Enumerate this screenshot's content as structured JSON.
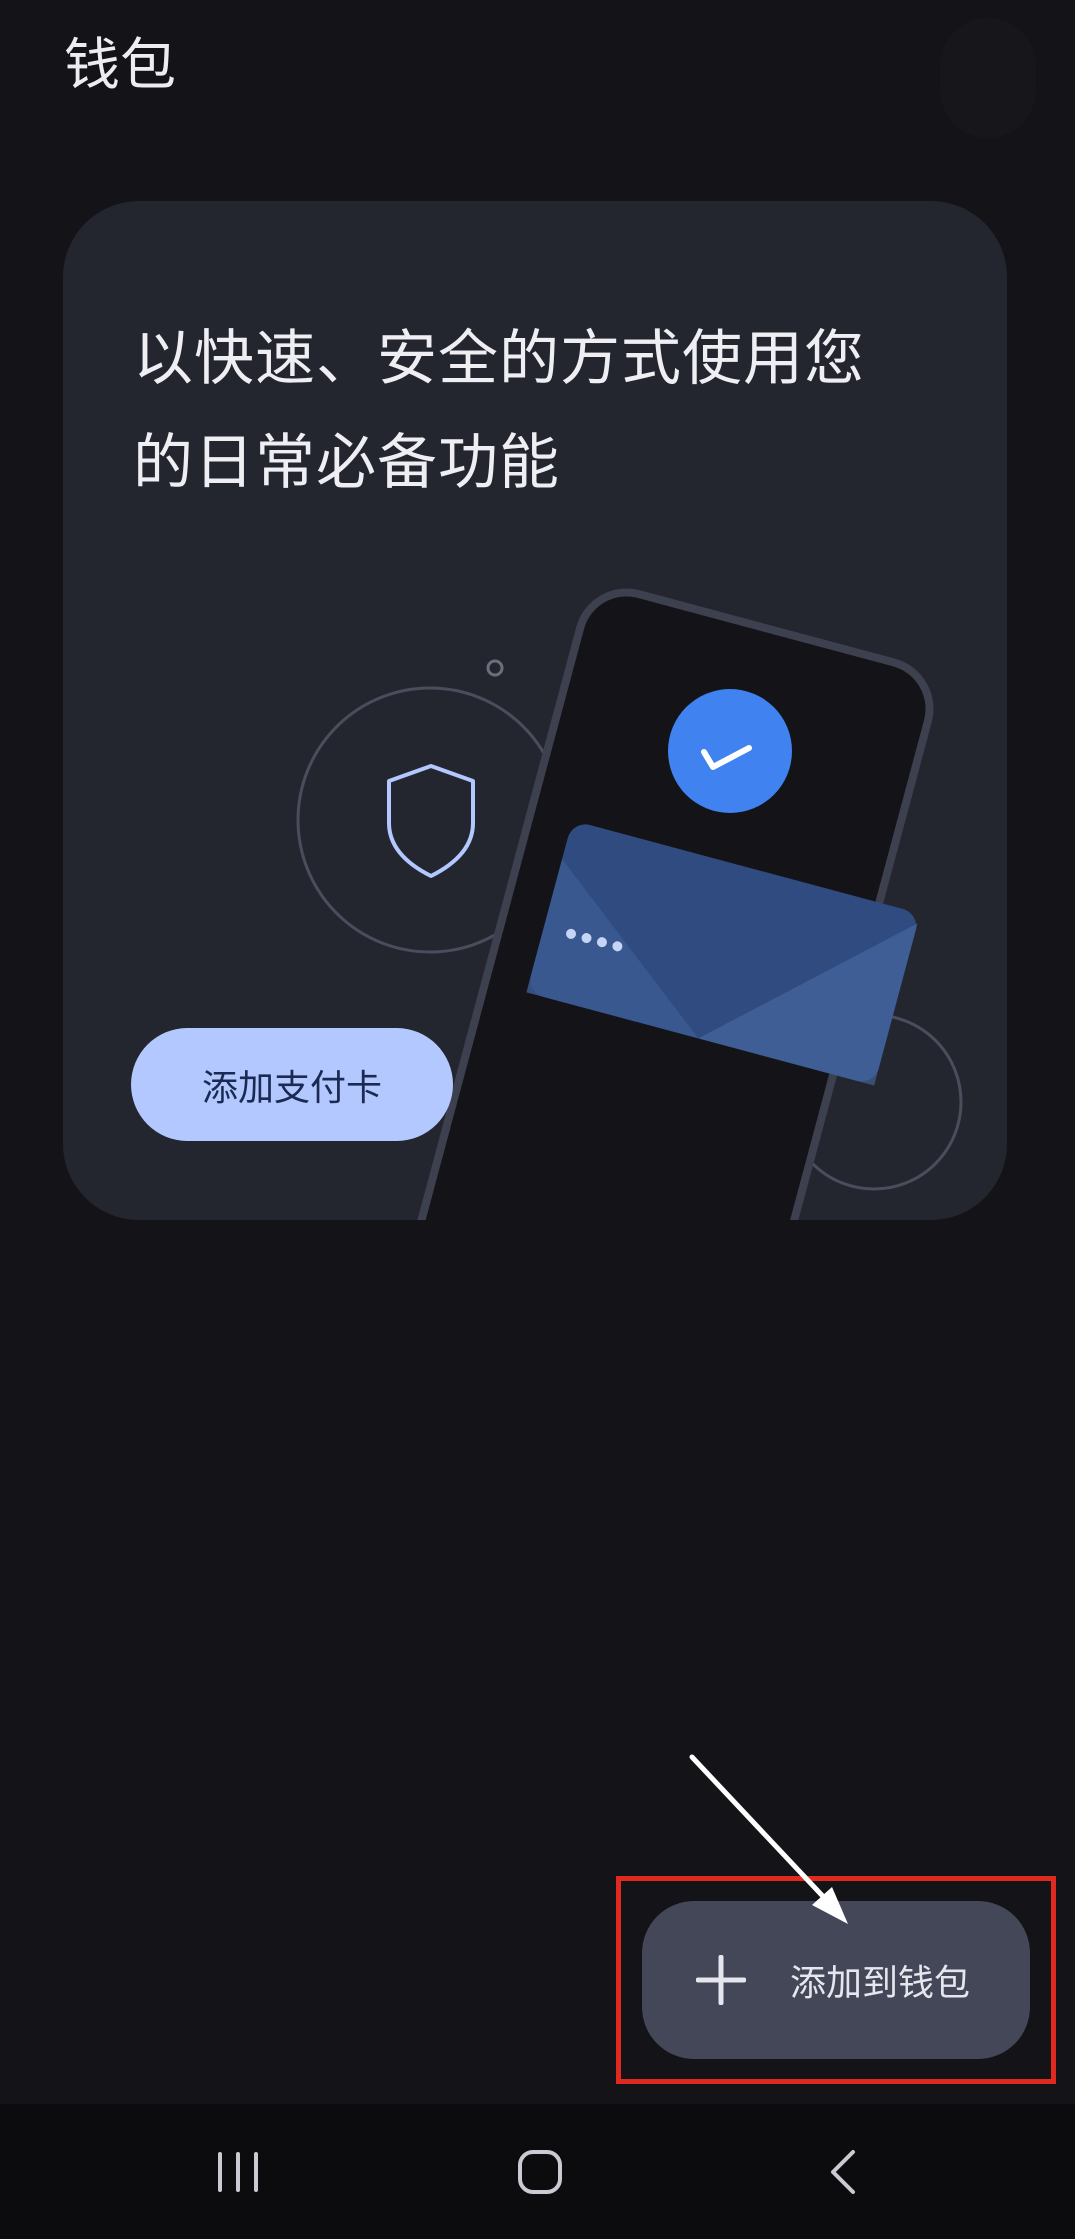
{
  "header": {
    "title": "钱包"
  },
  "card": {
    "headline_line1": "以快速、安全的方式使用您",
    "headline_line2": "的日常必备功能",
    "add_card_label": "添加支付卡",
    "illustration_icons": [
      "shield-icon",
      "check-icon",
      "payment-card-icon"
    ]
  },
  "fab": {
    "label": "添加到钱包",
    "icon": "plus-icon"
  },
  "nav": {
    "recents_icon": "recents-icon",
    "home_icon": "home-icon",
    "back_icon": "back-icon"
  },
  "colors": {
    "background": "#131318",
    "card": "#24262f",
    "accent_button": "#b3c8ff",
    "fab": "#434758",
    "check_circle": "#3f82f0",
    "highlight": "#e02a1f"
  }
}
